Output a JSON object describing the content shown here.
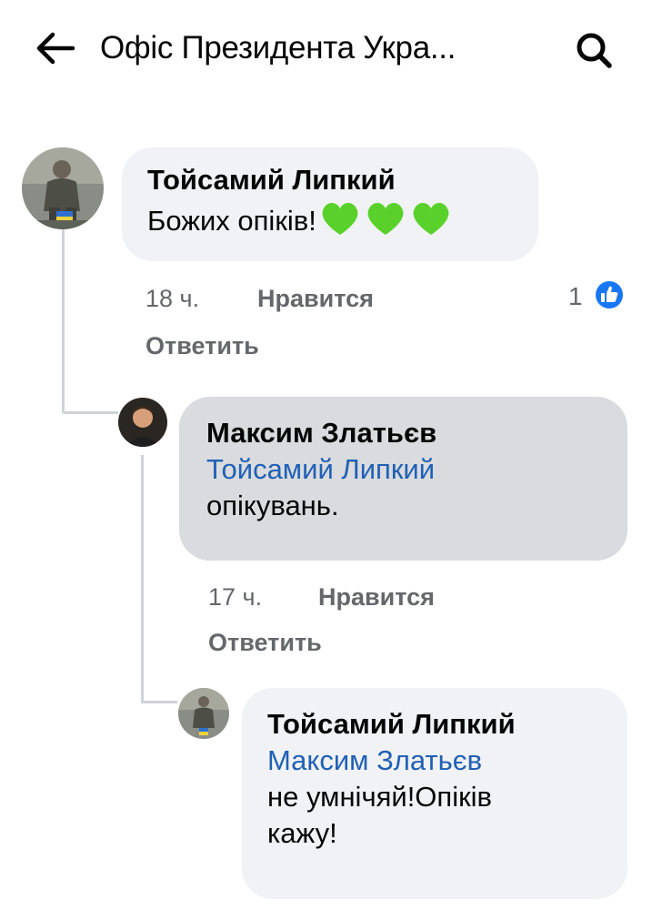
{
  "header": {
    "title": "Офіс Президента Укра...",
    "back_icon": "arrow-left-icon",
    "search_icon": "search-icon"
  },
  "comments": [
    {
      "author": "Тойсамий Липкий",
      "text": "Божих опіків!",
      "emoji": "green-heart ×3",
      "time": "18 ч.",
      "like_label": "Нравится",
      "reply_label": "Ответить",
      "reaction_count": "1",
      "reaction_icon": "like-badge-icon"
    },
    {
      "author": "Максим Златьєв",
      "mention": "Тойсамий Липкий",
      "text": "опікувань.",
      "time": "17 ч.",
      "like_label": "Нравится",
      "reply_label": "Ответить"
    },
    {
      "author": "Тойсамий Липкий",
      "mention": "Максим Златьєв",
      "text_line1": "не умнічяй!Опіків",
      "text_line2": "кажу!"
    }
  ],
  "colors": {
    "bubble": "#f0f2f5",
    "bubble_selected": "#d9dbde",
    "mention": "#2060b5",
    "meta": "#65676b",
    "like_blue": "#1877f2",
    "heart_green": "#5ad12b"
  }
}
